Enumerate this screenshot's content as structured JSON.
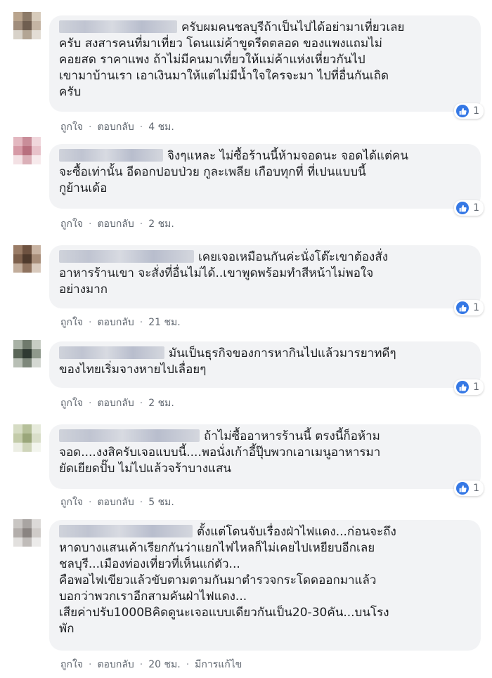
{
  "comments": [
    {
      "text": "ครับผมคนชลบุรีถ้าเป็นไปได้อย่ามาเที่ยวเลย\nครับ สงสารคนที่มาเที่ยว โดนแม่ค้าขูดรีดตลอด ของแพงแถมไม่\nคอยสด ราคาแพง ถ้าไม่มีคนมาเที่ยวให้แม่ค้าแห่งเหี่ยวกันไป\nเขามาบ้านเรา เอาเงินมาให้แต่ไม่มีน้ำใจใครจะมา ไปที่อื่นกันเถิด\nครับ",
      "reaction_count": "1",
      "like_label": "ถูกใจ",
      "reply_label": "ตอบกลับ",
      "time": "4 ชม."
    },
    {
      "text": "จิงๆแหละ ไม่ซื้อร้านนี้ห้ามจอดนะ จอดได้แต่คน\nจะซื้อเท่านั้น อีดอกปอบป่วย กูละเพลีย เกือบทุกที่ ที่เปนแบบนี้\nกูย้านเด้อ",
      "reaction_count": "1",
      "like_label": "ถูกใจ",
      "reply_label": "ตอบกลับ",
      "time": "2 ชม."
    },
    {
      "text": "เคยเจอเหมือนกันค่ะนั่งโต๊ะเขาต้องสั่ง\nอาหารร้านเขา จะสั่งที่อื่นไม่ได้..เขาพูดพร้อมทำสีหน้าไม่พอใจ\nอย่างมาก",
      "reaction_count": "1",
      "like_label": "ถูกใจ",
      "reply_label": "ตอบกลับ",
      "time": "21 ชม."
    },
    {
      "text": "มันเป็นธุรกิจของการหากินไปแล้วมารยาทดีๆ\nของไทยเริ่มจางหายไปเลื่อยๆ",
      "reaction_count": "1",
      "like_label": "ถูกใจ",
      "reply_label": "ตอบกลับ",
      "time": "2 ชม."
    },
    {
      "text": "ถ้าไม่ซื้ออาหารร้านนี้ ตรงนี้ก็อห้าม\nจอด....งงสิครับเจอแบบนี้....พอนั่งเก้าอี้ปุ๊บพวกเอาเมนูอาหารมา\nยัดเยียดปั๊บ ไม่ไปแล้วจร้าบางแสน",
      "reaction_count": "1",
      "like_label": "ถูกใจ",
      "reply_label": "ตอบกลับ",
      "time": "5 ชม."
    },
    {
      "text": "ตั้งแต่โดนจับเรื่องฝ่าไฟแดง...ก่อนจะถึง\nหาดบางแสนเค้าเรียกกันว่าแยกไฟไหลก็ไม่เคยไปเหยียบอีกเลย\nชลบุรี...เมืองท่องเที่ยวที่เห็นแก่ตัว...\nคือพอไฟเขียวแล้วขับตามตามกันมาตำรวจกระโดดออกมาแล้ว\nบอกว่าพวกเราอีกสามคันฝ่าไฟแดง...\nเสียค่าปรับ1000Bคิดดูนะเจอแบบเดียวกันเป็น20-30คัน...บนโรง\nพัก",
      "reaction_count": "",
      "like_label": "ถูกใจ",
      "reply_label": "ตอบกลับ",
      "time": "20 ชม.",
      "edited_label": "มีการแก้ไข"
    }
  ],
  "colors": {
    "bubble": "#f2f3f5",
    "like_blue": "#3578e5",
    "meta_text": "#606770"
  },
  "icons": {
    "reaction": "like-thumb-icon"
  }
}
